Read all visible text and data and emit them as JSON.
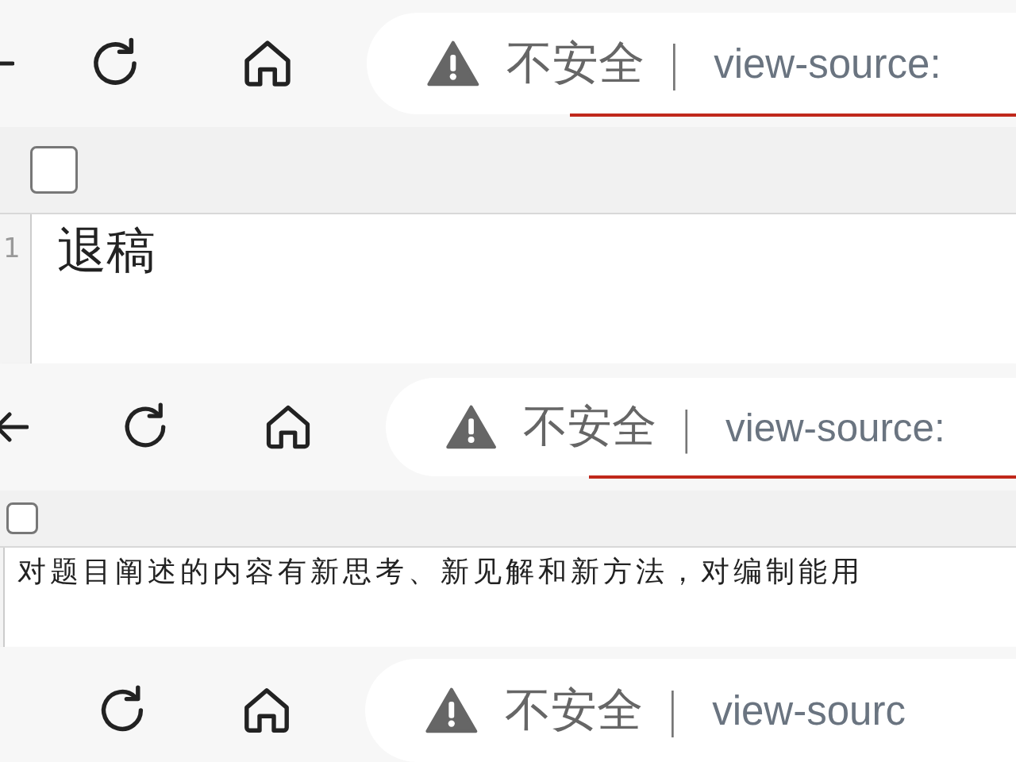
{
  "panels": [
    {
      "has_back": true,
      "security_label": "不安全",
      "separator": "|",
      "url": "view-source:",
      "underline": true,
      "checkbox": {
        "checked": false
      },
      "line_number": "1",
      "content": "退稿"
    },
    {
      "has_back": true,
      "security_label": "不安全",
      "separator": "|",
      "url": "view-source:",
      "underline": true,
      "checkbox": {
        "checked": false
      },
      "content": "对题目阐述的内容有新思考、新见解和新方法，对编制能用"
    },
    {
      "has_back": false,
      "security_label": "不安全",
      "separator": "|",
      "url": "view-sourc",
      "underline": false
    }
  ]
}
